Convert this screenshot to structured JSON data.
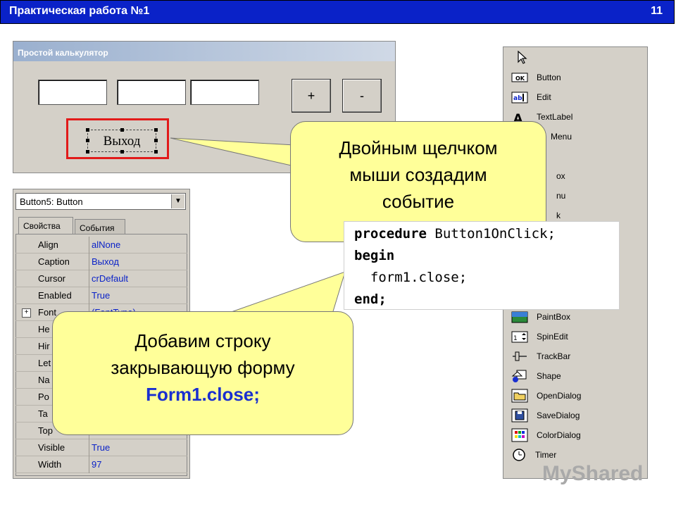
{
  "header": {
    "title": "Практическая работа №1",
    "slide_number": "11",
    "bg_color": "#0a22c8"
  },
  "calculator": {
    "window_title": "Простой калькулятор",
    "plus_label": "+",
    "minus_label": "-",
    "exit_label": "Выход"
  },
  "inspector": {
    "component": "Button5: Button",
    "tabs": [
      "Свойства",
      "События"
    ],
    "properties": [
      {
        "name": "Align",
        "value": "alNone"
      },
      {
        "name": "Caption",
        "value": "Выход"
      },
      {
        "name": "Cursor",
        "value": "crDefault"
      },
      {
        "name": "Enabled",
        "value": "True"
      },
      {
        "name": "Font",
        "value": "(FontType)"
      },
      {
        "name": "He",
        "value": ""
      },
      {
        "name": "Hir",
        "value": ""
      },
      {
        "name": "Let",
        "value": ""
      },
      {
        "name": "Na",
        "value": ""
      },
      {
        "name": "Po",
        "value": ""
      },
      {
        "name": "Ta",
        "value": ""
      },
      {
        "name": "Top",
        "value": ""
      },
      {
        "name": "Visible",
        "value": "True"
      },
      {
        "name": "Width",
        "value": "97"
      }
    ]
  },
  "palette": {
    "items": [
      {
        "label": "Button",
        "icon": "button-icon"
      },
      {
        "label": "Edit",
        "icon": "edit-icon"
      },
      {
        "label": "TextLabel",
        "icon": "label-icon"
      },
      {
        "label": "Menu",
        "icon": "menu-icon"
      },
      {
        "label": "ox",
        "icon": "box-icon"
      },
      {
        "label": "nu",
        "icon": "menu-icon"
      },
      {
        "label": "k",
        "icon": "check-icon"
      },
      {
        "label": "PaintBox",
        "icon": "paintbox-icon"
      },
      {
        "label": "SpinEdit",
        "icon": "spinedit-icon"
      },
      {
        "label": "TrackBar",
        "icon": "trackbar-icon"
      },
      {
        "label": "Shape",
        "icon": "shape-icon"
      },
      {
        "label": "OpenDialog",
        "icon": "open-folder-icon"
      },
      {
        "label": "SaveDialog",
        "icon": "save-disk-icon"
      },
      {
        "label": "ColorDialog",
        "icon": "color-grid-icon"
      },
      {
        "label": "Timer",
        "icon": "clock-icon"
      }
    ]
  },
  "callout_top": {
    "line1": "Двойным щелчком",
    "line2": "мыши создадим",
    "line3": "событие"
  },
  "callout_bottom": {
    "line1": "Добавим строку",
    "line2": "закрывающую форму",
    "line3": "Form1.close;",
    "accent_color": "#1a2fd0"
  },
  "code": {
    "kw1": "procedure",
    "proc_name": " Button1OnClick;",
    "kw2": "begin",
    "stmt": "  form1.close;",
    "kw3": "end;"
  },
  "watermark": "MyShared"
}
